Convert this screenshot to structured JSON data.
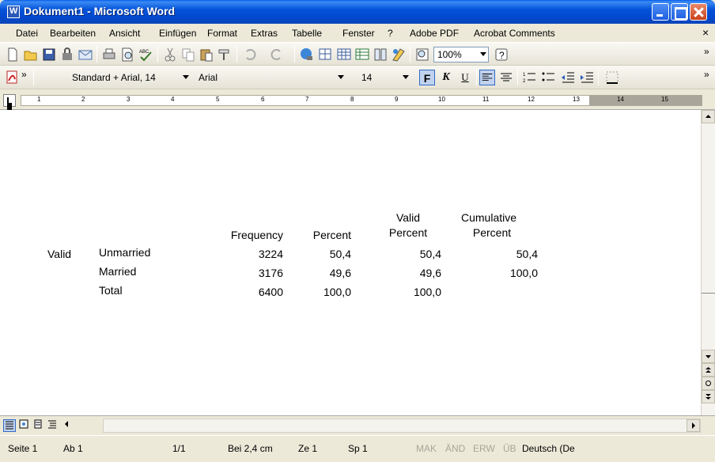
{
  "window": {
    "title": "Dokument1 - Microsoft Word"
  },
  "menu": {
    "items": [
      "Datei",
      "Bearbeiten",
      "Ansicht",
      "Einfügen",
      "Format",
      "Extras",
      "Tabelle",
      "Fenster",
      "?",
      "Adobe PDF",
      "Acrobat Comments"
    ],
    "close_symbol": "×"
  },
  "toolbar_standard": {
    "zoom": "100%",
    "overflow": "»"
  },
  "toolbar_format": {
    "style": "Standard + Arial, 14",
    "font": "Arial",
    "size": "14",
    "bold": "F",
    "italic": "K",
    "underline": "U",
    "overflow": "»"
  },
  "ruler": {
    "ticks": [
      "1",
      "2",
      "3",
      "4",
      "5",
      "6",
      "7",
      "8",
      "9",
      "10",
      "11",
      "12",
      "13",
      "14",
      "15"
    ]
  },
  "table": {
    "headers": {
      "frequency": "Frequency",
      "percent": "Percent",
      "valid_percent_1": "Valid",
      "valid_percent_2": "Percent",
      "cumulative_percent_1": "Cumulative",
      "cumulative_percent_2": "Percent"
    },
    "row_label": "Valid",
    "rows": [
      {
        "label": "Unmarried",
        "frequency": "3224",
        "percent": "50,4",
        "valid_percent": "50,4",
        "cumulative_percent": "50,4"
      },
      {
        "label": "Married",
        "frequency": "3176",
        "percent": "49,6",
        "valid_percent": "49,6",
        "cumulative_percent": "100,0"
      },
      {
        "label": "Total",
        "frequency": "6400",
        "percent": "100,0",
        "valid_percent": "100,0",
        "cumulative_percent": ""
      }
    ]
  },
  "status": {
    "page": "Seite 1",
    "section": "Ab 1",
    "pages": "1/1",
    "position": "Bei 2,4 cm",
    "line": "Ze 1",
    "column": "Sp 1",
    "mak": "MAK",
    "and": "ÄND",
    "erw": "ERW",
    "ub": "ÜB",
    "language": "Deutsch (De"
  }
}
